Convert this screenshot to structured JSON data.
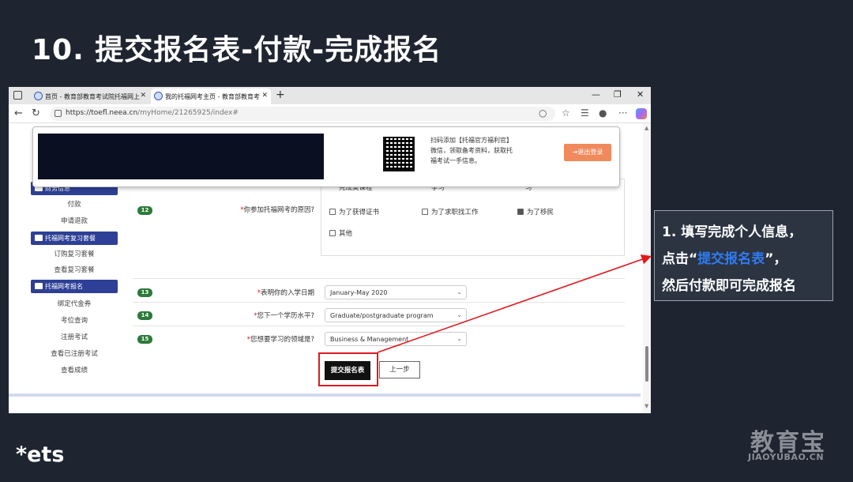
{
  "slide": {
    "title": "10. 提交报名表-付款-完成报名",
    "brand_logo": "*ets",
    "watermark_main": "教育宝",
    "watermark_sub": "JIAOYUBAO.CN"
  },
  "browser": {
    "tabs": [
      {
        "label": "首页 - 教育部教育考试院托福网上",
        "active": false
      },
      {
        "label": "我的托福网考主页 - 教育部教育考",
        "active": true
      }
    ],
    "url_domain": "https://toefl.neea.cn",
    "url_path": "/myHome/21265925/index#"
  },
  "overlay": {
    "qr_text": "扫码添加【托福官方福利官】微信，领取备考资料，获取托福考试一手信息。",
    "logout_label": "退出登录"
  },
  "sidebar": {
    "items": [
      {
        "label": "财务信息",
        "type": "header"
      },
      {
        "label": "付款",
        "type": "item"
      },
      {
        "label": "申请退款",
        "type": "item"
      },
      {
        "label": "托福网考复习套餐",
        "type": "header"
      },
      {
        "label": "订购复习套餐",
        "type": "item"
      },
      {
        "label": "查看复习套餐",
        "type": "item"
      },
      {
        "label": "托福网考报名",
        "type": "header"
      },
      {
        "label": "绑定代金券",
        "type": "item"
      },
      {
        "label": "考位查询",
        "type": "item"
      },
      {
        "label": "注册考试",
        "type": "item"
      },
      {
        "label": "查看已注册考试",
        "type": "item"
      },
      {
        "label": "查看成绩",
        "type": "item"
      }
    ]
  },
  "form": {
    "q12": {
      "number": "12",
      "label": "你参加托福网考的原因?",
      "options_partial": [
        "完成美课程",
        "学习",
        "习"
      ],
      "options": [
        {
          "label": "为了获得证书",
          "checked": false
        },
        {
          "label": "为了求职找工作",
          "checked": false
        },
        {
          "label": "为了移民",
          "checked": true
        },
        {
          "label": "其他",
          "checked": false
        }
      ]
    },
    "q13": {
      "number": "13",
      "label": "表明你的入学日期",
      "value": "January-May 2020"
    },
    "q14": {
      "number": "14",
      "label": "您下一个学历水平?",
      "value": "Graduate/postgraduate program"
    },
    "q15": {
      "number": "15",
      "label": "您想要学习的领域是?",
      "value": "Business & Management"
    },
    "submit_label": "提交报名表",
    "prev_label": "上一步"
  },
  "callout": {
    "line1": "1. 填写完成个人信息，",
    "line2_prefix": "点击“",
    "line2_highlight": "提交报名表",
    "line2_suffix": "”，",
    "line3": "然后付款即可完成报名"
  },
  "colors": {
    "background": "#1f2530",
    "accent_red": "#e0191f",
    "highlight_blue": "#2f7bf2",
    "menu_header_blue": "#2d3f96",
    "logout_orange": "#f08a5d",
    "badge_green": "#2c7a3a"
  }
}
